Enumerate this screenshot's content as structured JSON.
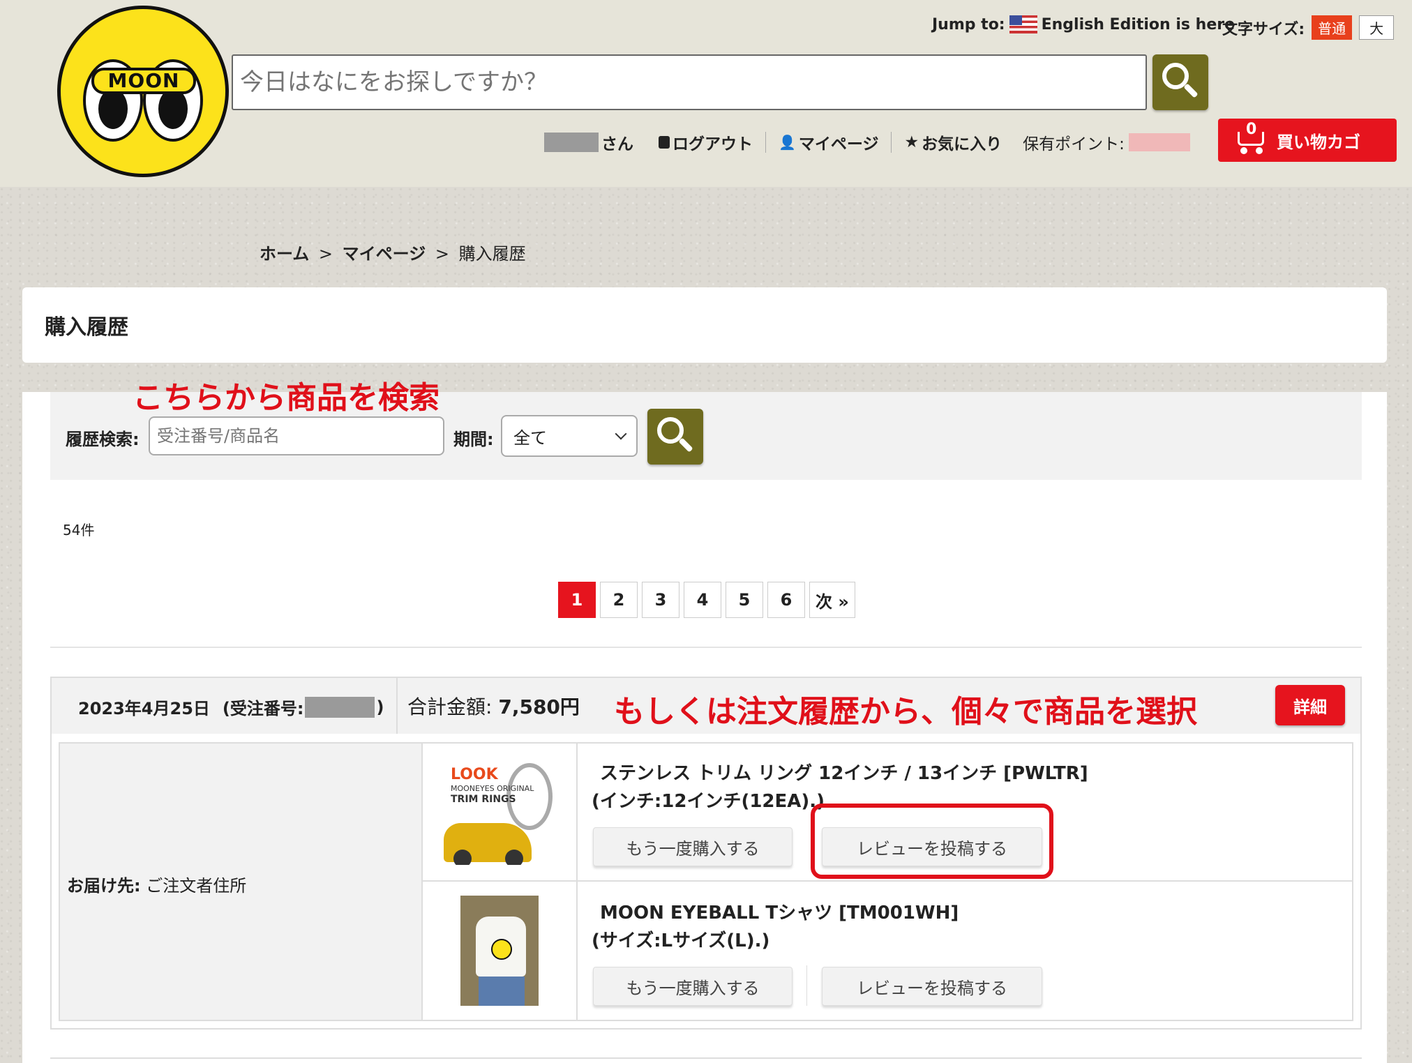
{
  "header": {
    "logo_text": "MOON",
    "search_placeholder": "今日はなにをお探しですか？",
    "jump_label": "Jump to:",
    "english_link": "English Edition is here",
    "font_size_label": "文字サイズ:",
    "font_size_normal": "普通",
    "font_size_large": "大",
    "user_suffix": "さん",
    "logout": "ログアウト",
    "mypage": "マイページ",
    "favorites": "お気に入り",
    "points_label": "保有ポイント:",
    "cart_count": "0",
    "cart_label": "買い物カゴ"
  },
  "breadcrumb": {
    "home": "ホーム",
    "mypage": "マイページ",
    "current": "購入履歴",
    "sep": ">"
  },
  "page_title": "購入履歴",
  "annotations": {
    "search_note": "こちらから商品を検索",
    "select_note": "もしくは注文履歴から、個々で商品を選択"
  },
  "filter": {
    "history_label": "履歴検索:",
    "history_placeholder": "受注番号/商品名",
    "period_label": "期間:",
    "period_value": "全て"
  },
  "result_count": "54件",
  "pager": {
    "pages": [
      "1",
      "2",
      "3",
      "4",
      "5",
      "6"
    ],
    "next": "次 »",
    "current": "1"
  },
  "order": {
    "date": "2023年4月25日",
    "order_no_label": "(受注番号:",
    "order_no_close": ")",
    "total_label": "合計金額:",
    "total_value": "7,580円",
    "detail_button": "詳細",
    "delivery_label": "お届け先:",
    "delivery_value": "ご注文者住所",
    "items": [
      {
        "name": "ステンレス トリム リング 12インチ / 13インチ [PWLTR]",
        "option": "(インチ:12インチ(12EA).)",
        "thumb": {
          "look": "LOOK",
          "sub": "MOONEYES ORIGINAL",
          "rings": "TRIM RINGS"
        },
        "rebuy": "もう一度購入する",
        "review": "レビューを投稿する"
      },
      {
        "name": "MOON EYEBALL Tシャツ [TM001WH]",
        "option": "(サイズ:Lサイズ(L).)",
        "rebuy": "もう一度購入する",
        "review": "レビューを投稿する"
      }
    ]
  },
  "colors": {
    "accent_red": "#e6141e",
    "olive": "#6f6b1f",
    "logo_yellow": "#fce21b"
  }
}
